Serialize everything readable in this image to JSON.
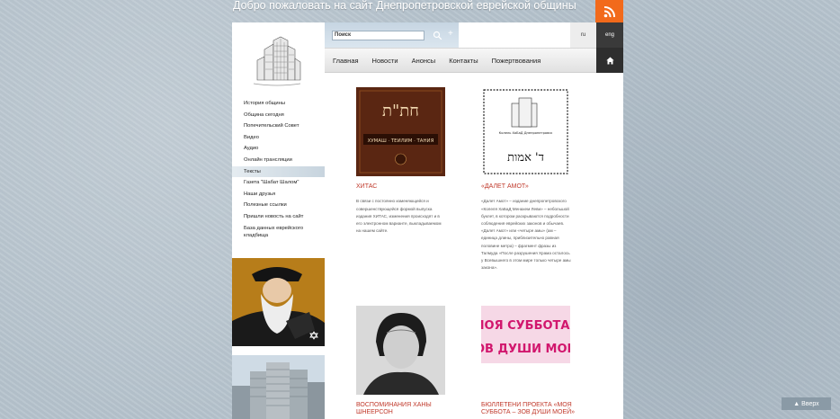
{
  "header": {
    "site_title": "Добро пожаловать на сайт Днепропетровской еврейской общины",
    "rss_icon": "rss-icon",
    "accent_color": "#f26a1b"
  },
  "search": {
    "placeholder": "Поиск",
    "button_icon": "search-icon",
    "plus_icon": "plus-icon"
  },
  "lang": {
    "ru": "ru",
    "eng": "eng"
  },
  "nav": {
    "items": [
      "Главная",
      "Новости",
      "Анонсы",
      "Контакты",
      "Пожертвования"
    ],
    "home_icon": "home-icon"
  },
  "sidebar": {
    "items": [
      "История общины",
      "Община сегодня",
      "Попечительский Совет",
      "Видео",
      "Аудио",
      "Онлайн трансляции",
      "Тексты",
      "Газета \"Шабат Шалом\"",
      "Наши друзья",
      "Полезные ссылки",
      "Пришли новость на сайт",
      "База данных еврейского кладбища"
    ],
    "active_index": 6
  },
  "cards": [
    {
      "title": "ХИТАС",
      "text": "В связи с постоянно изменяющейся и совершенствующейся формой выпуска издания ХИТАС, изменения происходят и в его электронном варианте, выкладываемом на нашем сайте.",
      "thumb_lines": [
        "חת\"ת",
        "ХУМАШ · ТЕИЛИМ · ТАНИЯ"
      ]
    },
    {
      "title": "«ДАЛЕТ АМОТ»",
      "text": "«Далет Амот» – издание днепропетровского «Колеля ХаБаД Менахем Леви» – небольшой буклет, в котором раскрываются подробности соблюдения еврейских законов и обычаев. «Далет Амот» или «четыре амы» (ам – единица длины, приблизительно равная половине метра) – фрагмент фразы из Талмуда «После разрушения Храма осталось у Всевышнего в этом мире только четыре амы закона».",
      "thumb_lines": [
        "Колель ХаБаД Днепропетровск",
        "ד' אמות"
      ]
    },
    {
      "title": "ВОСПОМИНАНИЯ ХАНЫ ШНЕЕРСОН",
      "text": ""
    },
    {
      "title": "БЮЛЛЕТЕНИ ПРОЕКТА «МОЯ СУББОТА – ЗОВ ДУШИ МОЕЙ»",
      "text": "",
      "thumb_lines": [
        "МОЯ СУББОТА -",
        "ЗОВ ДУШИ МОЕЙ"
      ]
    }
  ],
  "footer": {
    "up_label": "▲ Вверх"
  }
}
